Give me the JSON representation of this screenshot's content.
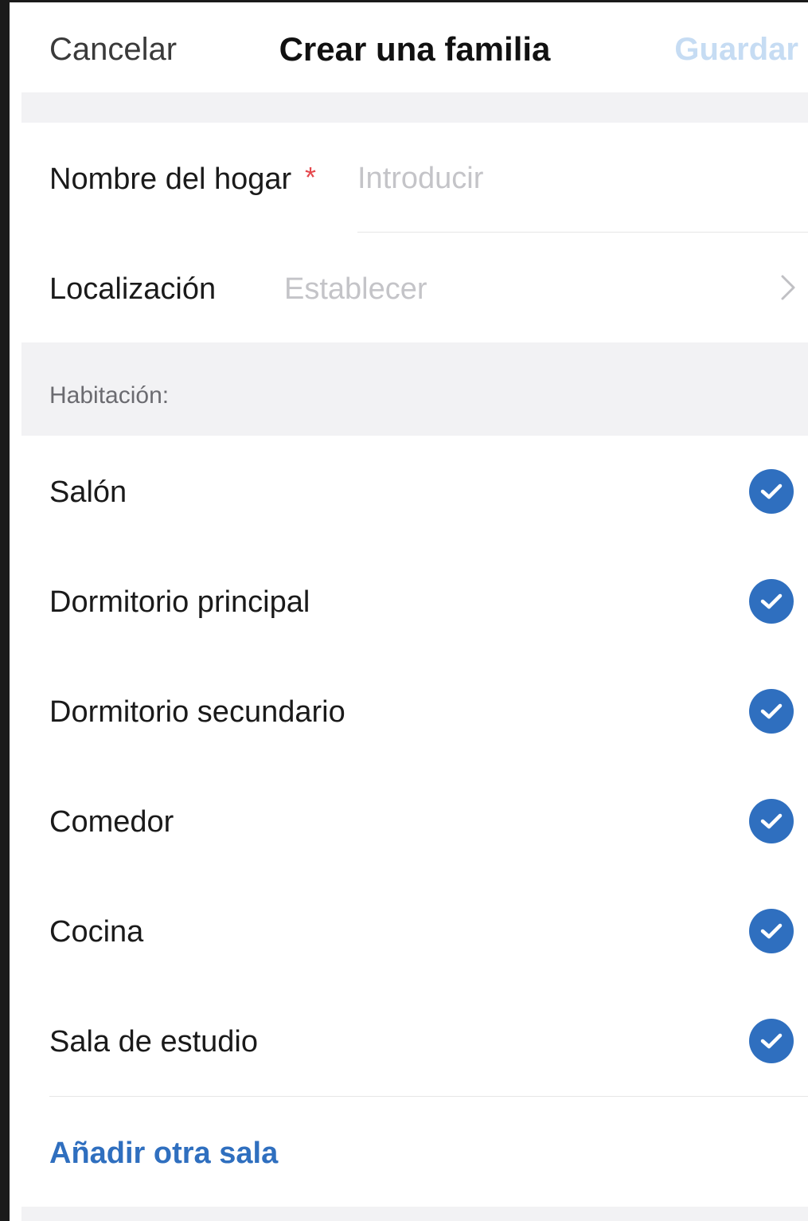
{
  "header": {
    "cancel_label": "Cancelar",
    "title": "Crear una familia",
    "save_label": "Guardar"
  },
  "form": {
    "home_name": {
      "label": "Nombre del hogar",
      "required_mark": "*",
      "placeholder": "Introducir",
      "value": ""
    },
    "location": {
      "label": "Localización",
      "placeholder": "Establecer",
      "chevron_icon": "chevron-right-icon"
    }
  },
  "rooms_section": {
    "label": "Habitación:",
    "check_icon": "checkmark-circle-icon",
    "items": [
      {
        "name": "Salón",
        "checked": true
      },
      {
        "name": "Dormitorio principal",
        "checked": true
      },
      {
        "name": "Dormitorio secundario",
        "checked": true
      },
      {
        "name": "Comedor",
        "checked": true
      },
      {
        "name": "Cocina",
        "checked": true
      },
      {
        "name": "Sala de estudio",
        "checked": true
      }
    ],
    "add_room_label": "Añadir otra sala"
  },
  "colors": {
    "accent": "#2f6fbf",
    "save_disabled": "#c6dcf3",
    "required": "#e5484d",
    "placeholder": "#c4c4c8",
    "section_bg": "#f2f2f4"
  }
}
